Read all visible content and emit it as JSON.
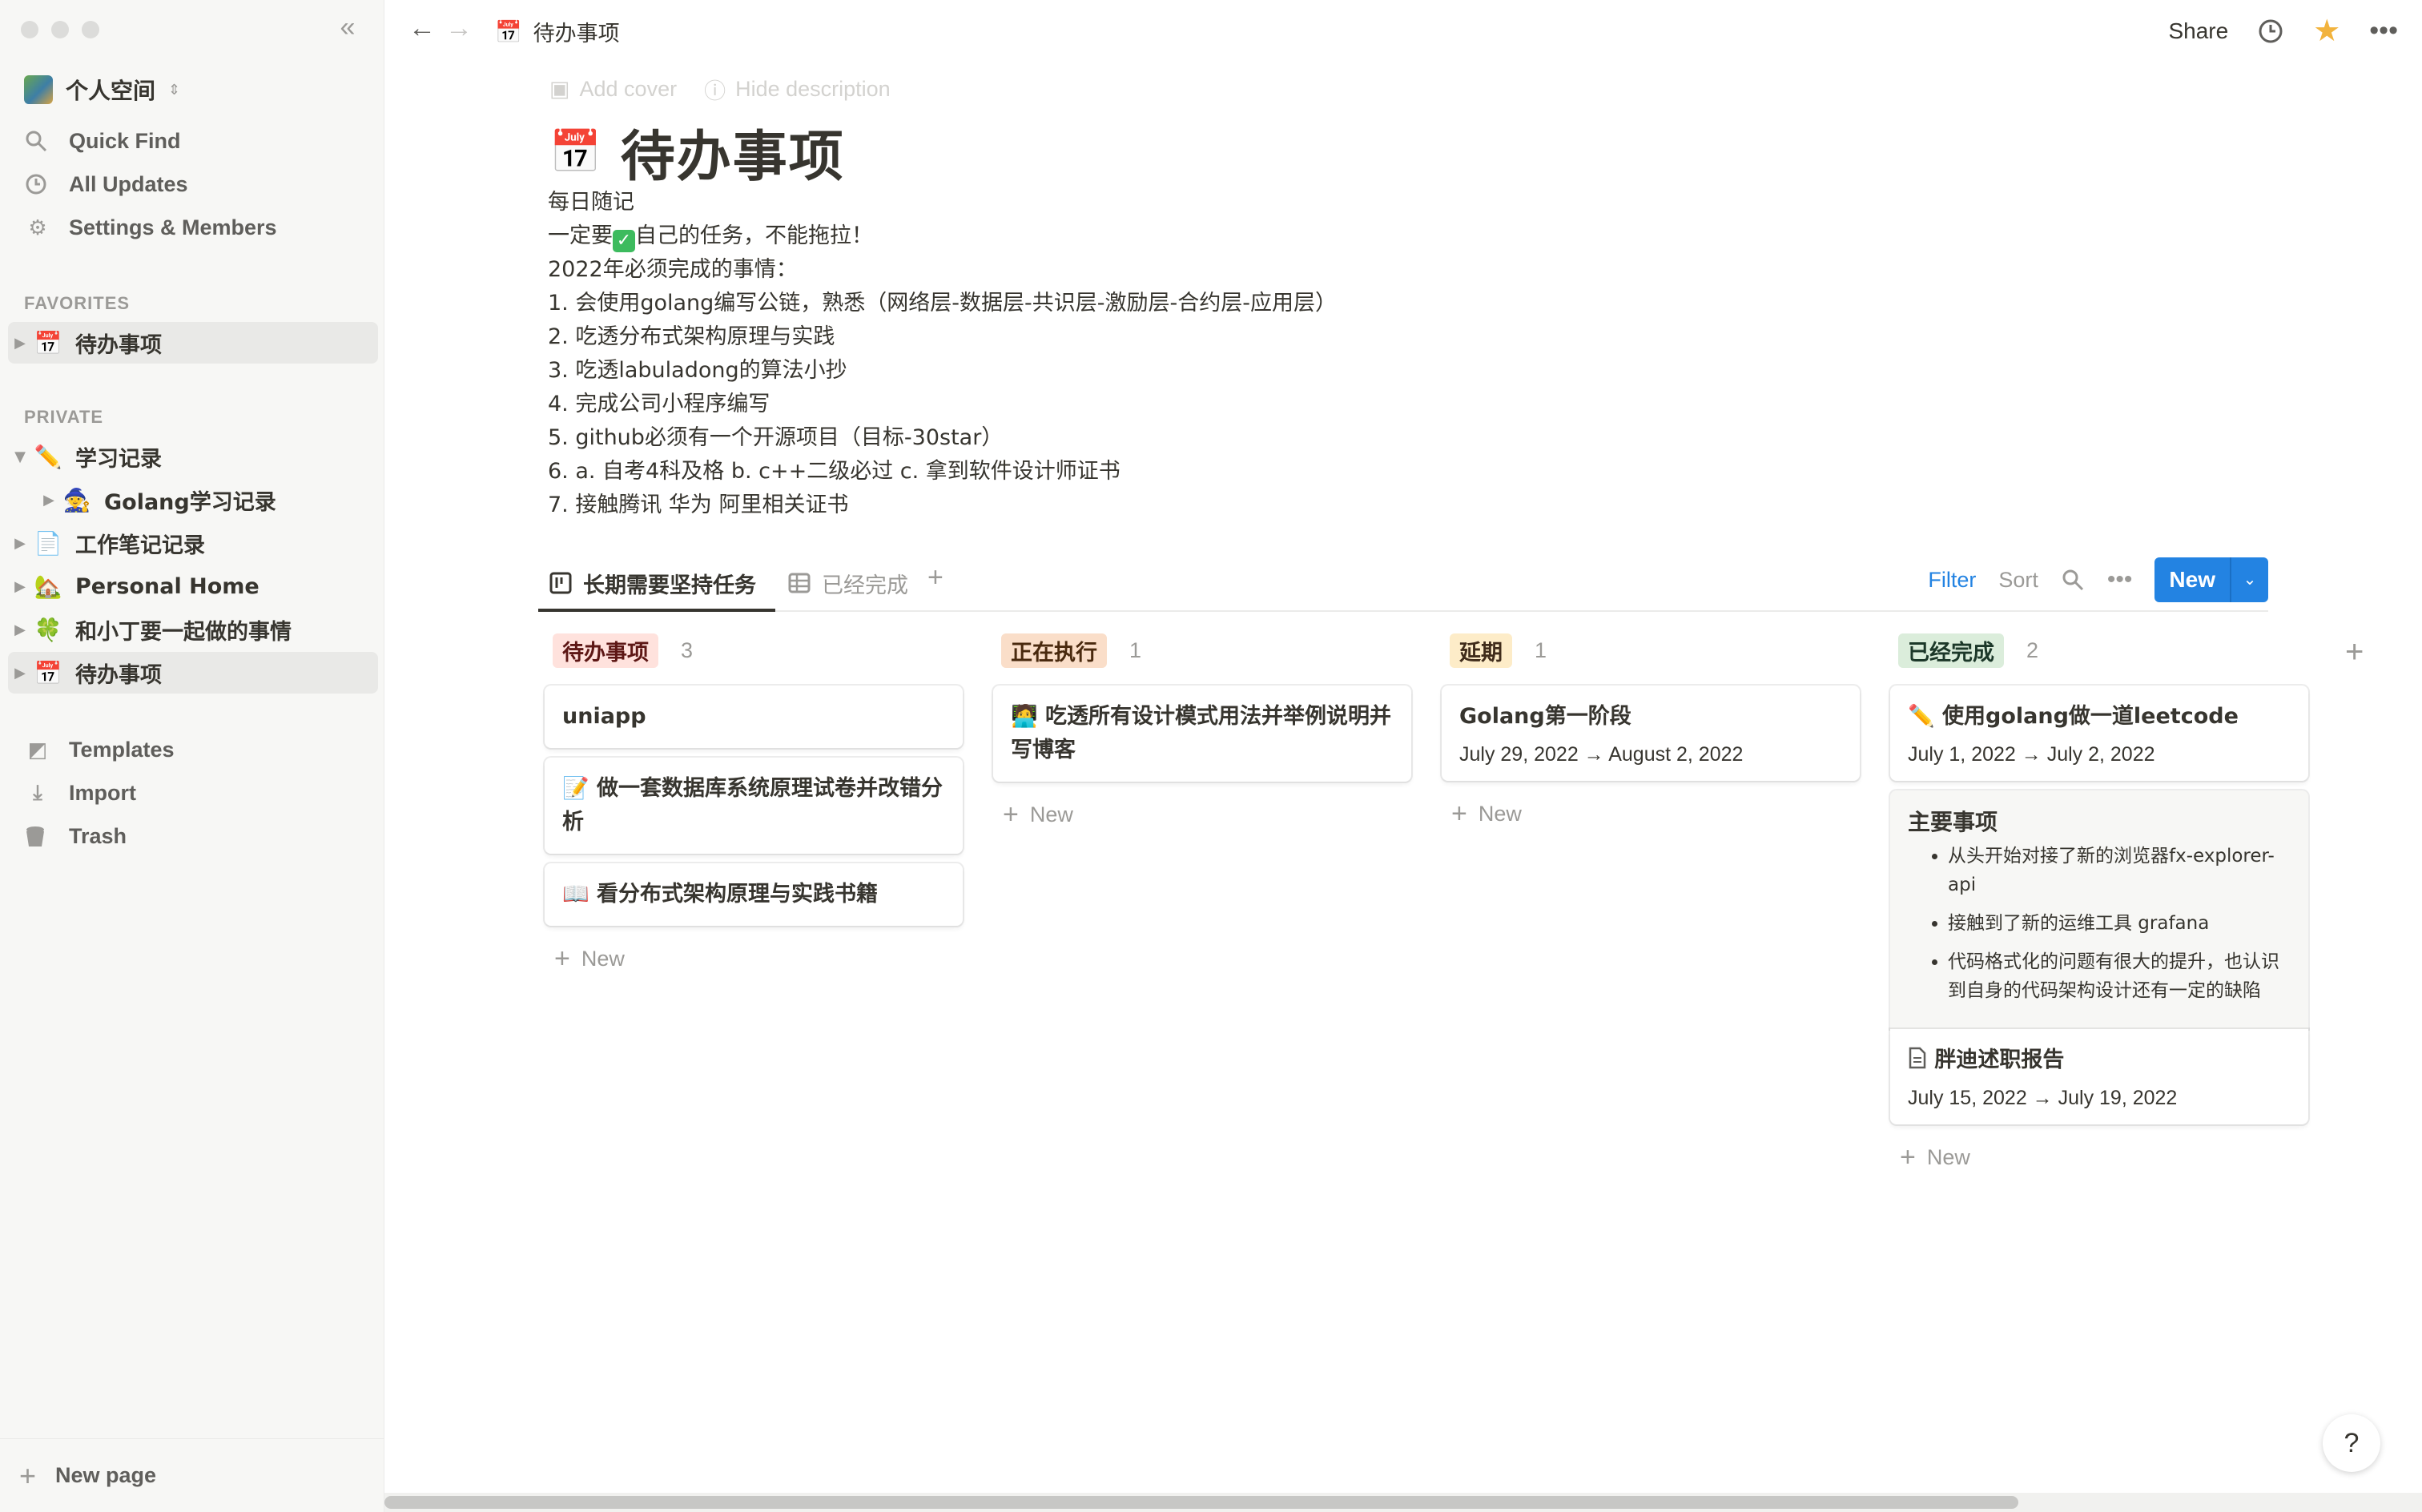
{
  "sidebar": {
    "workspace_name": "个人空间",
    "nav": [
      {
        "label": "Quick Find",
        "icon": "search-icon"
      },
      {
        "label": "All Updates",
        "icon": "clock-icon"
      },
      {
        "label": "Settings & Members",
        "icon": "gear-icon"
      }
    ],
    "favorites_label": "FAVORITES",
    "favorites": [
      {
        "emoji": "📅",
        "label": "待办事项"
      }
    ],
    "private_label": "PRIVATE",
    "private": [
      {
        "emoji": "✏️",
        "label": "学习记录"
      },
      {
        "emoji": "🧙",
        "label": "Golang学习记录"
      },
      {
        "emoji": "📄",
        "label": "工作笔记记录"
      },
      {
        "emoji": "🏡",
        "label": "Personal Home"
      },
      {
        "emoji": "🍀",
        "label": "和小丁要一起做的事情"
      },
      {
        "emoji": "📅",
        "label": "待办事项"
      }
    ],
    "bottom": [
      {
        "label": "Templates",
        "icon": "templates-icon"
      },
      {
        "label": "Import",
        "icon": "import-icon"
      },
      {
        "label": "Trash",
        "icon": "trash-icon"
      }
    ],
    "new_page": "New page"
  },
  "topbar": {
    "breadcrumb_emoji": "📅",
    "breadcrumb": "待办事项",
    "share": "Share"
  },
  "page": {
    "add_cover": "Add cover",
    "hide_description": "Hide description",
    "emoji": "📅",
    "title": "待办事项",
    "desc_line1": "每日随记",
    "desc_line2_a": "一定要",
    "desc_line2_check": "✓",
    "desc_line2_b": "自己的任务，不能拖拉！",
    "desc_lines": [
      "2022年必须完成的事情：",
      "1. 会使用golang编写公链，熟悉（网络层-数据层-共识层-激励层-合约层-应用层）",
      "2. 吃透分布式架构原理与实践",
      "3. 吃透labuladong的算法小抄",
      "4. 完成公司小程序编写",
      "5. github必须有一个开源项目（目标-30star）",
      "6. a. 自考4科及格 b. c++二级必过 c. 拿到软件设计师证书",
      "7. 接触腾讯 华为 阿里相关证书"
    ]
  },
  "views": {
    "tabs": [
      {
        "label": "长期需要坚持任务",
        "icon": "board-icon"
      },
      {
        "label": "已经完成",
        "icon": "table-icon"
      }
    ],
    "filter": "Filter",
    "sort": "Sort",
    "new": "New"
  },
  "board": {
    "add_new": "New",
    "columns": [
      {
        "name": "待办事项",
        "count": "3",
        "tag_bg": "#ffe2dd",
        "tag_fg": "#5d1715",
        "cards": [
          {
            "emoji": "",
            "title": "uniapp"
          },
          {
            "emoji": "📝",
            "title": "做一套数据库系统原理试卷并改错分析"
          },
          {
            "emoji": "📖",
            "title": "看分布式架构原理与实践书籍"
          }
        ]
      },
      {
        "name": "正在执行",
        "count": "1",
        "tag_bg": "#fadec9",
        "tag_fg": "#49290e",
        "cards": [
          {
            "emoji": "🧑‍💻",
            "title": "吃透所有设计模式用法并举例说明并写博客"
          }
        ]
      },
      {
        "name": "延期",
        "count": "1",
        "tag_bg": "#fdecc8",
        "tag_fg": "#402c1b",
        "cards": [
          {
            "emoji": "",
            "title": "Golang第一阶段",
            "date": "July 29, 2022 → August 2, 2022"
          }
        ]
      },
      {
        "name": "已经完成",
        "count": "2",
        "tag_bg": "#dbeddb",
        "tag_fg": "#1c3829",
        "cards": [
          {
            "emoji": "✏️",
            "title": "使用golang做一道leetcode",
            "date": "July 1, 2022 → July 2, 2022"
          },
          {
            "preview_heading": "主要事项",
            "preview_items": [
              "从头开始对接了新的浏览器fx-explorer-api",
              "接触到了新的运维工具 grafana",
              "代码格式化的问题有很大的提升，也认识到自身的代码架构设计还有一定的缺陷"
            ],
            "title": "胖迪述职报告",
            "date": "July 15, 2022 → July 19, 2022"
          }
        ]
      }
    ]
  },
  "help": "?"
}
